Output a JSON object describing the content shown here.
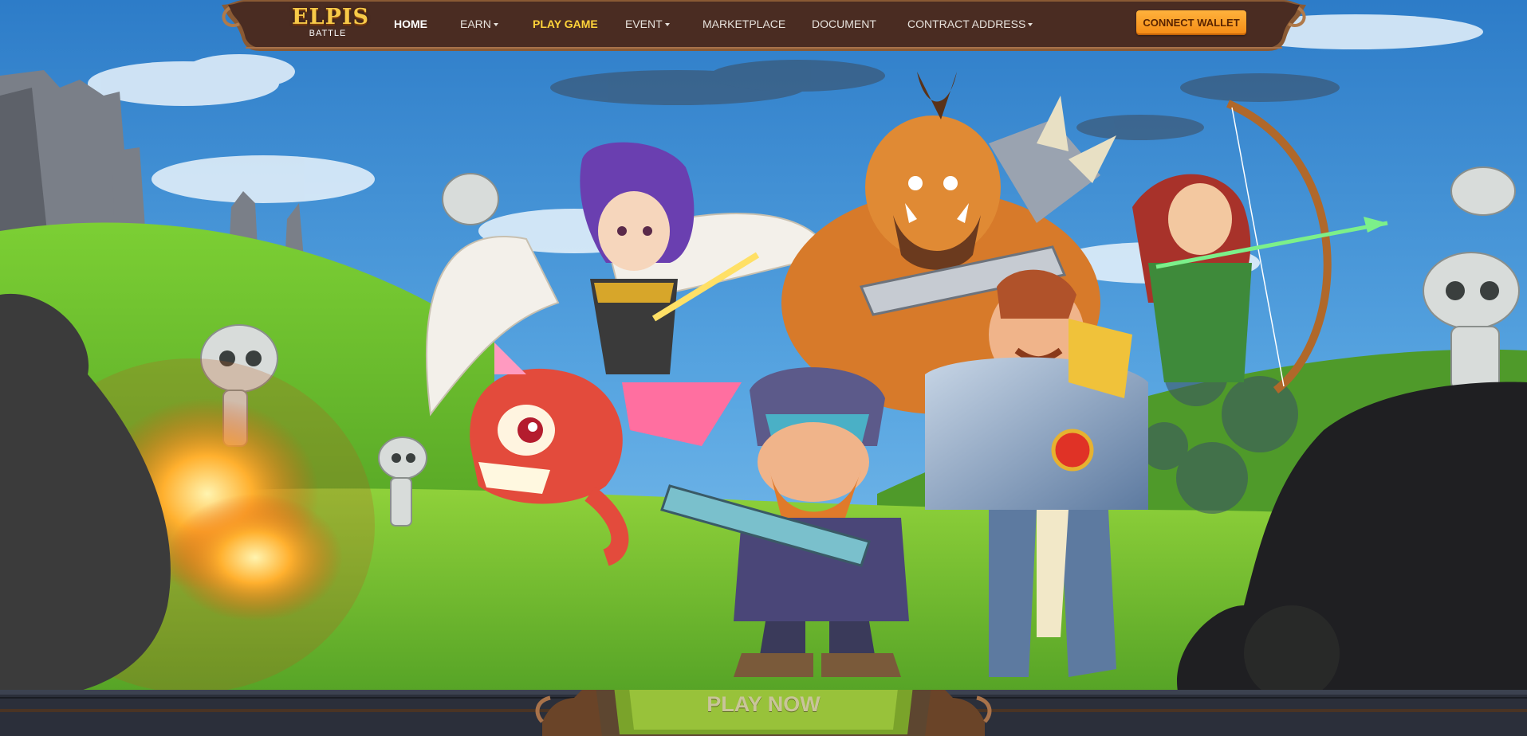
{
  "logo": {
    "title": "ELPIS",
    "subtitle": "BATTLE"
  },
  "nav": {
    "items": [
      {
        "label": "HOME",
        "state": "active",
        "dropdown": false
      },
      {
        "label": "EARN",
        "state": "normal",
        "dropdown": true
      },
      {
        "label": "PLAY GAME",
        "state": "highlight",
        "dropdown": false
      },
      {
        "label": "EVENT",
        "state": "normal",
        "dropdown": true
      },
      {
        "label": "MARKETPLACE",
        "state": "normal",
        "dropdown": false
      },
      {
        "label": "DOCUMENT",
        "state": "normal",
        "dropdown": false
      },
      {
        "label": "CONTRACT ADDRESS",
        "state": "normal",
        "dropdown": true
      }
    ],
    "connect_wallet_label": "CONNECT WALLET"
  },
  "hero": {
    "play_button_label": "PLAY NOW"
  },
  "colors": {
    "nav_bg": "#4a2c22",
    "nav_trim": "#8a5a34",
    "accent_orange": "#f5a02a",
    "highlight_yellow": "#ffd43a",
    "sky": "#3f8fd6",
    "grass": "#6fbf2c"
  }
}
